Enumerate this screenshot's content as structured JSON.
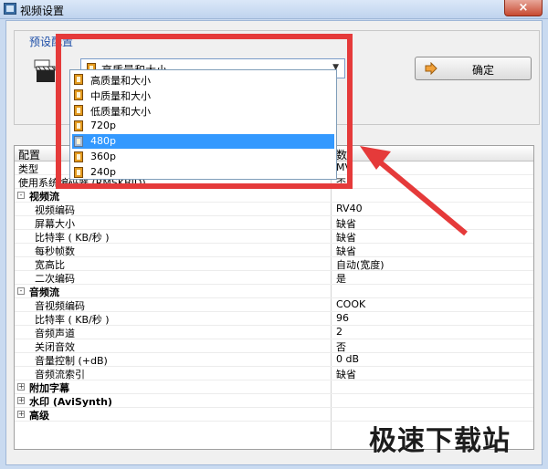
{
  "window": {
    "title": "视频设置",
    "close": "×"
  },
  "preset": {
    "legend": "预设配置",
    "selected": "高质量和大小",
    "ok_label": "确定",
    "options": [
      "高质量和大小",
      "中质量和大小",
      "低质量和大小",
      "720p",
      "480p",
      "360p",
      "240p"
    ],
    "highlighted": "480p"
  },
  "grid": {
    "headers": {
      "name": "配置",
      "value": "数"
    },
    "rows": [
      {
        "kind": "plain",
        "k": "类型",
        "v": "MV"
      },
      {
        "kind": "plain",
        "k": "使用系统编码器 (RMSKBID)",
        "v": "否"
      },
      {
        "kind": "cat",
        "k": "视频流",
        "v": "",
        "toggle": "-"
      },
      {
        "kind": "sub",
        "k": "视频编码",
        "v": "RV40"
      },
      {
        "kind": "sub",
        "k": "屏幕大小",
        "v": "缺省"
      },
      {
        "kind": "sub",
        "k": "比特率 ( KB/秒 )",
        "v": "缺省"
      },
      {
        "kind": "sub",
        "k": "每秒帧数",
        "v": "缺省"
      },
      {
        "kind": "sub",
        "k": "宽高比",
        "v": "自动(宽度)"
      },
      {
        "kind": "sub",
        "k": "二次编码",
        "v": "是"
      },
      {
        "kind": "cat",
        "k": "音频流",
        "v": "",
        "toggle": "-"
      },
      {
        "kind": "sub",
        "k": "音视频编码",
        "v": "COOK"
      },
      {
        "kind": "sub",
        "k": "比特率 ( KB/秒 )",
        "v": "96"
      },
      {
        "kind": "sub",
        "k": "音频声道",
        "v": "2"
      },
      {
        "kind": "sub",
        "k": "关闭音效",
        "v": "否"
      },
      {
        "kind": "sub",
        "k": "音量控制 (+dB)",
        "v": "0 dB"
      },
      {
        "kind": "sub",
        "k": "音频流索引",
        "v": "缺省"
      },
      {
        "kind": "cat",
        "k": "附加字幕",
        "v": "",
        "toggle": "+"
      },
      {
        "kind": "cat",
        "k": "水印 (AviSynth)",
        "v": "",
        "toggle": "+"
      },
      {
        "kind": "cat",
        "k": "高级",
        "v": "",
        "toggle": "+"
      }
    ]
  },
  "watermark": "极速下载站",
  "colors": {
    "highlight": "#3399ff",
    "annotation": "#e53a3a"
  }
}
